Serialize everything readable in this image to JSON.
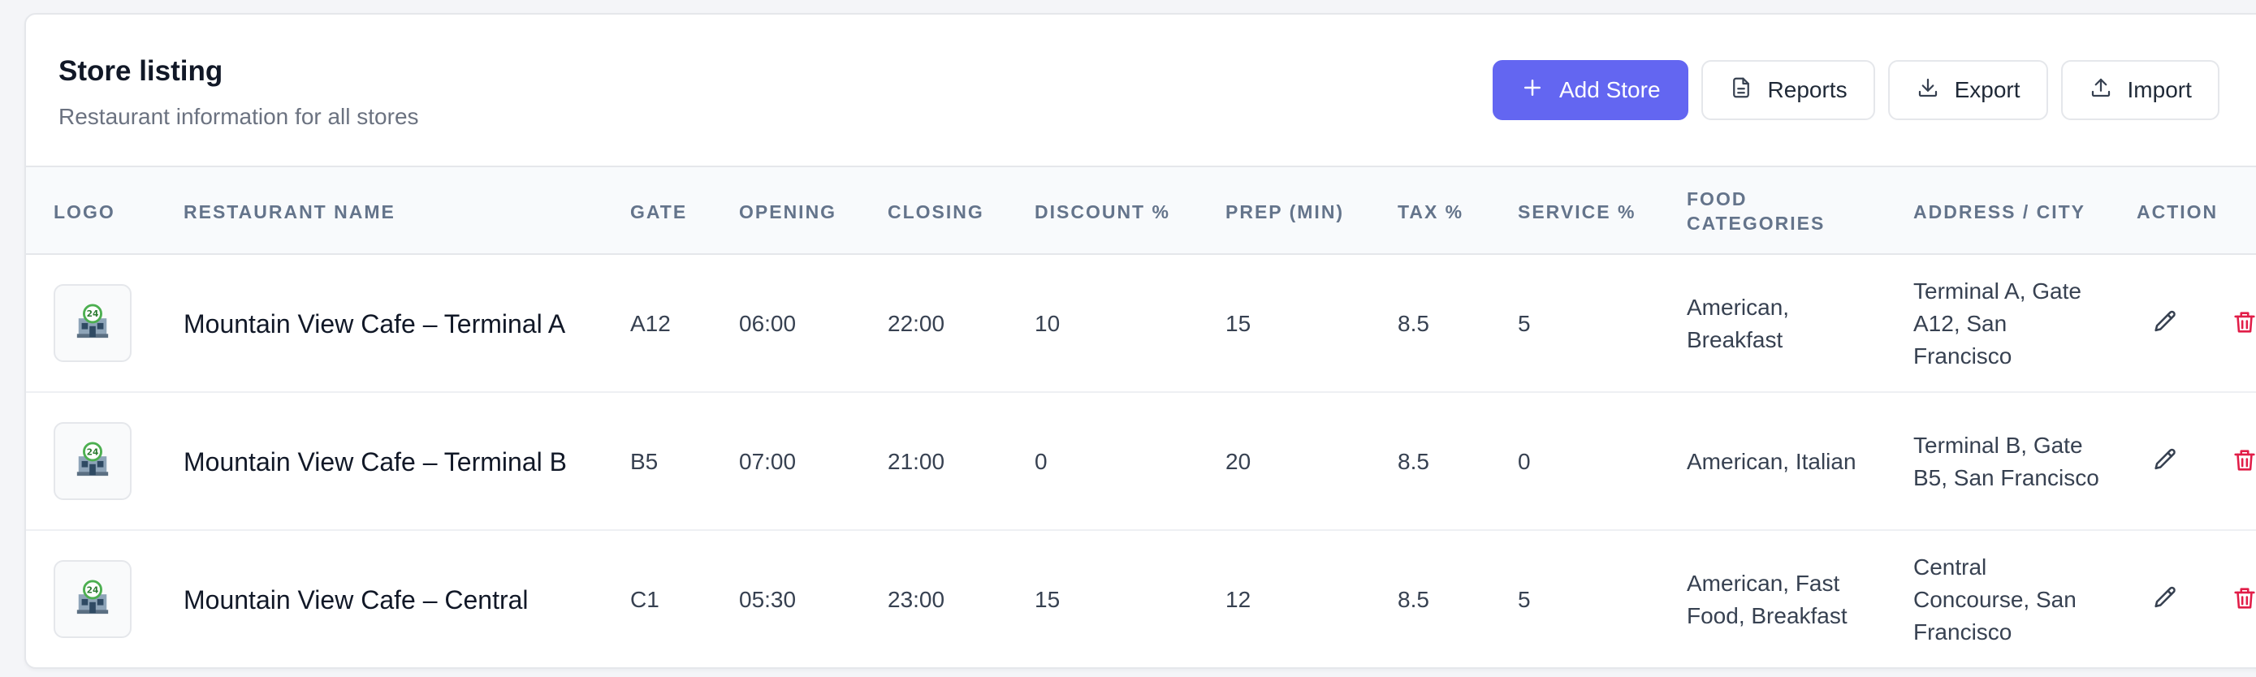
{
  "header": {
    "title": "Store listing",
    "subtitle": "Restaurant information for all stores"
  },
  "toolbar": {
    "add_label": "Add Store",
    "reports_label": "Reports",
    "export_label": "Export",
    "import_label": "Import"
  },
  "table": {
    "columns": {
      "logo": "LOGO",
      "name": "RESTAURANT NAME",
      "gate": "GATE",
      "opening": "OPENING",
      "closing": "CLOSING",
      "discount": "DISCOUNT %",
      "prep": "PREP (MIN)",
      "tax": "TAX %",
      "service": "SERVICE %",
      "categories": "FOOD CATEGORIES",
      "address": "ADDRESS / CITY",
      "action": "ACTION"
    },
    "rows": [
      {
        "logo_icon": "store-24-icon",
        "name": "Mountain View Cafe – Terminal A",
        "gate": "A12",
        "opening": "06:00",
        "closing": "22:00",
        "discount": "10",
        "prep": "15",
        "tax": "8.5",
        "service": "5",
        "categories": "American, Breakfast",
        "address": "Terminal A, Gate A12, San Francisco"
      },
      {
        "logo_icon": "store-24-icon",
        "name": "Mountain View Cafe – Terminal B",
        "gate": "B5",
        "opening": "07:00",
        "closing": "21:00",
        "discount": "0",
        "prep": "20",
        "tax": "8.5",
        "service": "0",
        "categories": "American, Italian",
        "address": "Terminal B, Gate B5, San Francisco"
      },
      {
        "logo_icon": "store-24-icon",
        "name": "Mountain View Cafe – Central",
        "gate": "C1",
        "opening": "05:30",
        "closing": "23:00",
        "discount": "15",
        "prep": "12",
        "tax": "8.5",
        "service": "5",
        "categories": "American, Fast Food, Breakfast",
        "address": "Central Concourse, San Francisco"
      }
    ]
  },
  "colors": {
    "primary": "#6366f1",
    "delete": "#e11d48",
    "header_bg": "#f8fafc"
  },
  "icons": {
    "add": "plus-icon",
    "reports": "document-icon",
    "export": "download-icon",
    "import": "upload-icon",
    "edit": "pencil-icon",
    "delete": "trash-icon"
  }
}
